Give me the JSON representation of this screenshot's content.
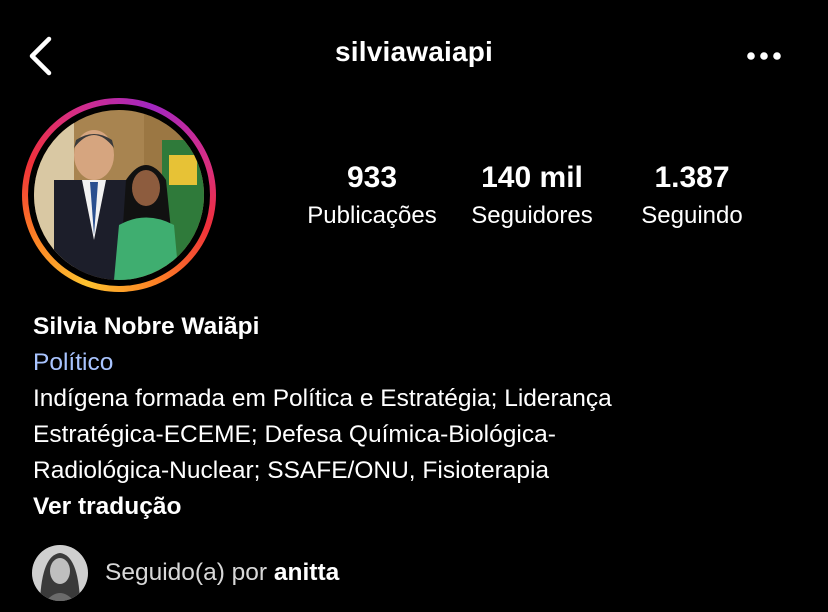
{
  "header": {
    "username": "silviawaiapi",
    "back_icon": "chevron-left-icon",
    "more_icon": "more-horizontal-icon"
  },
  "profile": {
    "avatar_icon": "profile-photo",
    "stats": [
      {
        "value": "933",
        "label": "Publicações"
      },
      {
        "value": "140 mil",
        "label": "Seguidores"
      },
      {
        "value": "1.387",
        "label": "Seguindo"
      }
    ]
  },
  "bio": {
    "name": "Silvia Nobre Waiãpi",
    "category": "Político",
    "lines": [
      "Indígena formada em Política e Estratégia; Liderança",
      "Estratégica-ECEME; Defesa Química-Biológica-",
      "Radiológica-Nuclear; SSAFE/ONU, Fisioterapia"
    ],
    "translate_label": "Ver tradução"
  },
  "followed_by": {
    "prefix": "Seguido(a) por",
    "user": "anitta"
  },
  "colors": {
    "background": "#000000",
    "text": "#ffffff",
    "category": "#a9c4ff",
    "ring_gradient": [
      "#fdc22f",
      "#fd7e25",
      "#f0303a",
      "#d42d8a",
      "#a227c1"
    ]
  }
}
